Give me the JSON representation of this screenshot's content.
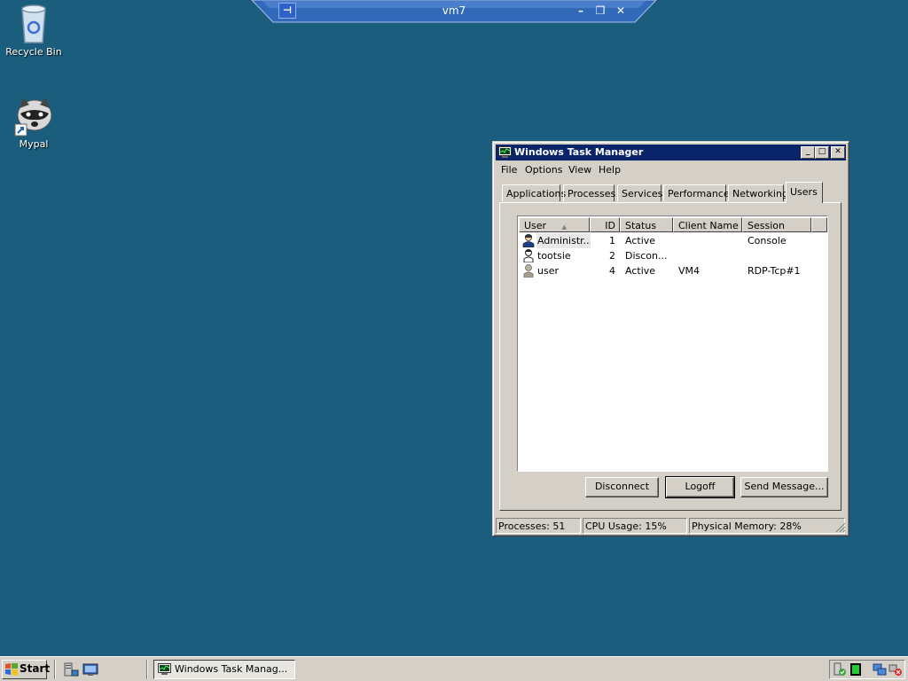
{
  "desktop": {
    "icons": [
      {
        "label": "Recycle Bin",
        "icon": "recycle-bin-icon"
      },
      {
        "label": "Mypal",
        "icon": "raccoon-app-icon"
      }
    ]
  },
  "rdp_bar": {
    "title": "vm7",
    "pin_icon": "pin-icon",
    "minimize": "–",
    "restore": "❐",
    "close": "✕"
  },
  "window": {
    "title": "Windows Task Manager",
    "controls": {
      "minimize": "_",
      "maximize": "□",
      "close": "✕"
    },
    "menu": [
      "File",
      "Options",
      "View",
      "Help"
    ],
    "tabs": [
      "Applications",
      "Processes",
      "Services",
      "Performance",
      "Networking",
      "Users"
    ],
    "active_tab": "Users",
    "columns": [
      "User",
      "ID",
      "Status",
      "Client Name",
      "Session"
    ],
    "sort_indicator": "▲",
    "rows": [
      {
        "user": "Administr...",
        "id": "1",
        "status": "Active",
        "client": "",
        "session": "Console",
        "icon": "admin-user-icon"
      },
      {
        "user": "tootsie",
        "id": "2",
        "status": "Discon...",
        "client": "",
        "session": "",
        "icon": "user-icon"
      },
      {
        "user": "user",
        "id": "4",
        "status": "Active",
        "client": "VM4",
        "session": "RDP-Tcp#1",
        "icon": "generic-user-icon"
      }
    ],
    "buttons": {
      "disconnect": "Disconnect",
      "logoff": "Logoff",
      "send_message": "Send Message..."
    },
    "status": {
      "processes": "Processes: 51",
      "cpu": "CPU Usage: 15%",
      "memory": "Physical Memory: 28%"
    }
  },
  "taskbar": {
    "start": "Start",
    "task": "Windows Task Manag...",
    "colors": {
      "desktop": "#1b5d7d",
      "titlebar": "#0a246a"
    }
  }
}
